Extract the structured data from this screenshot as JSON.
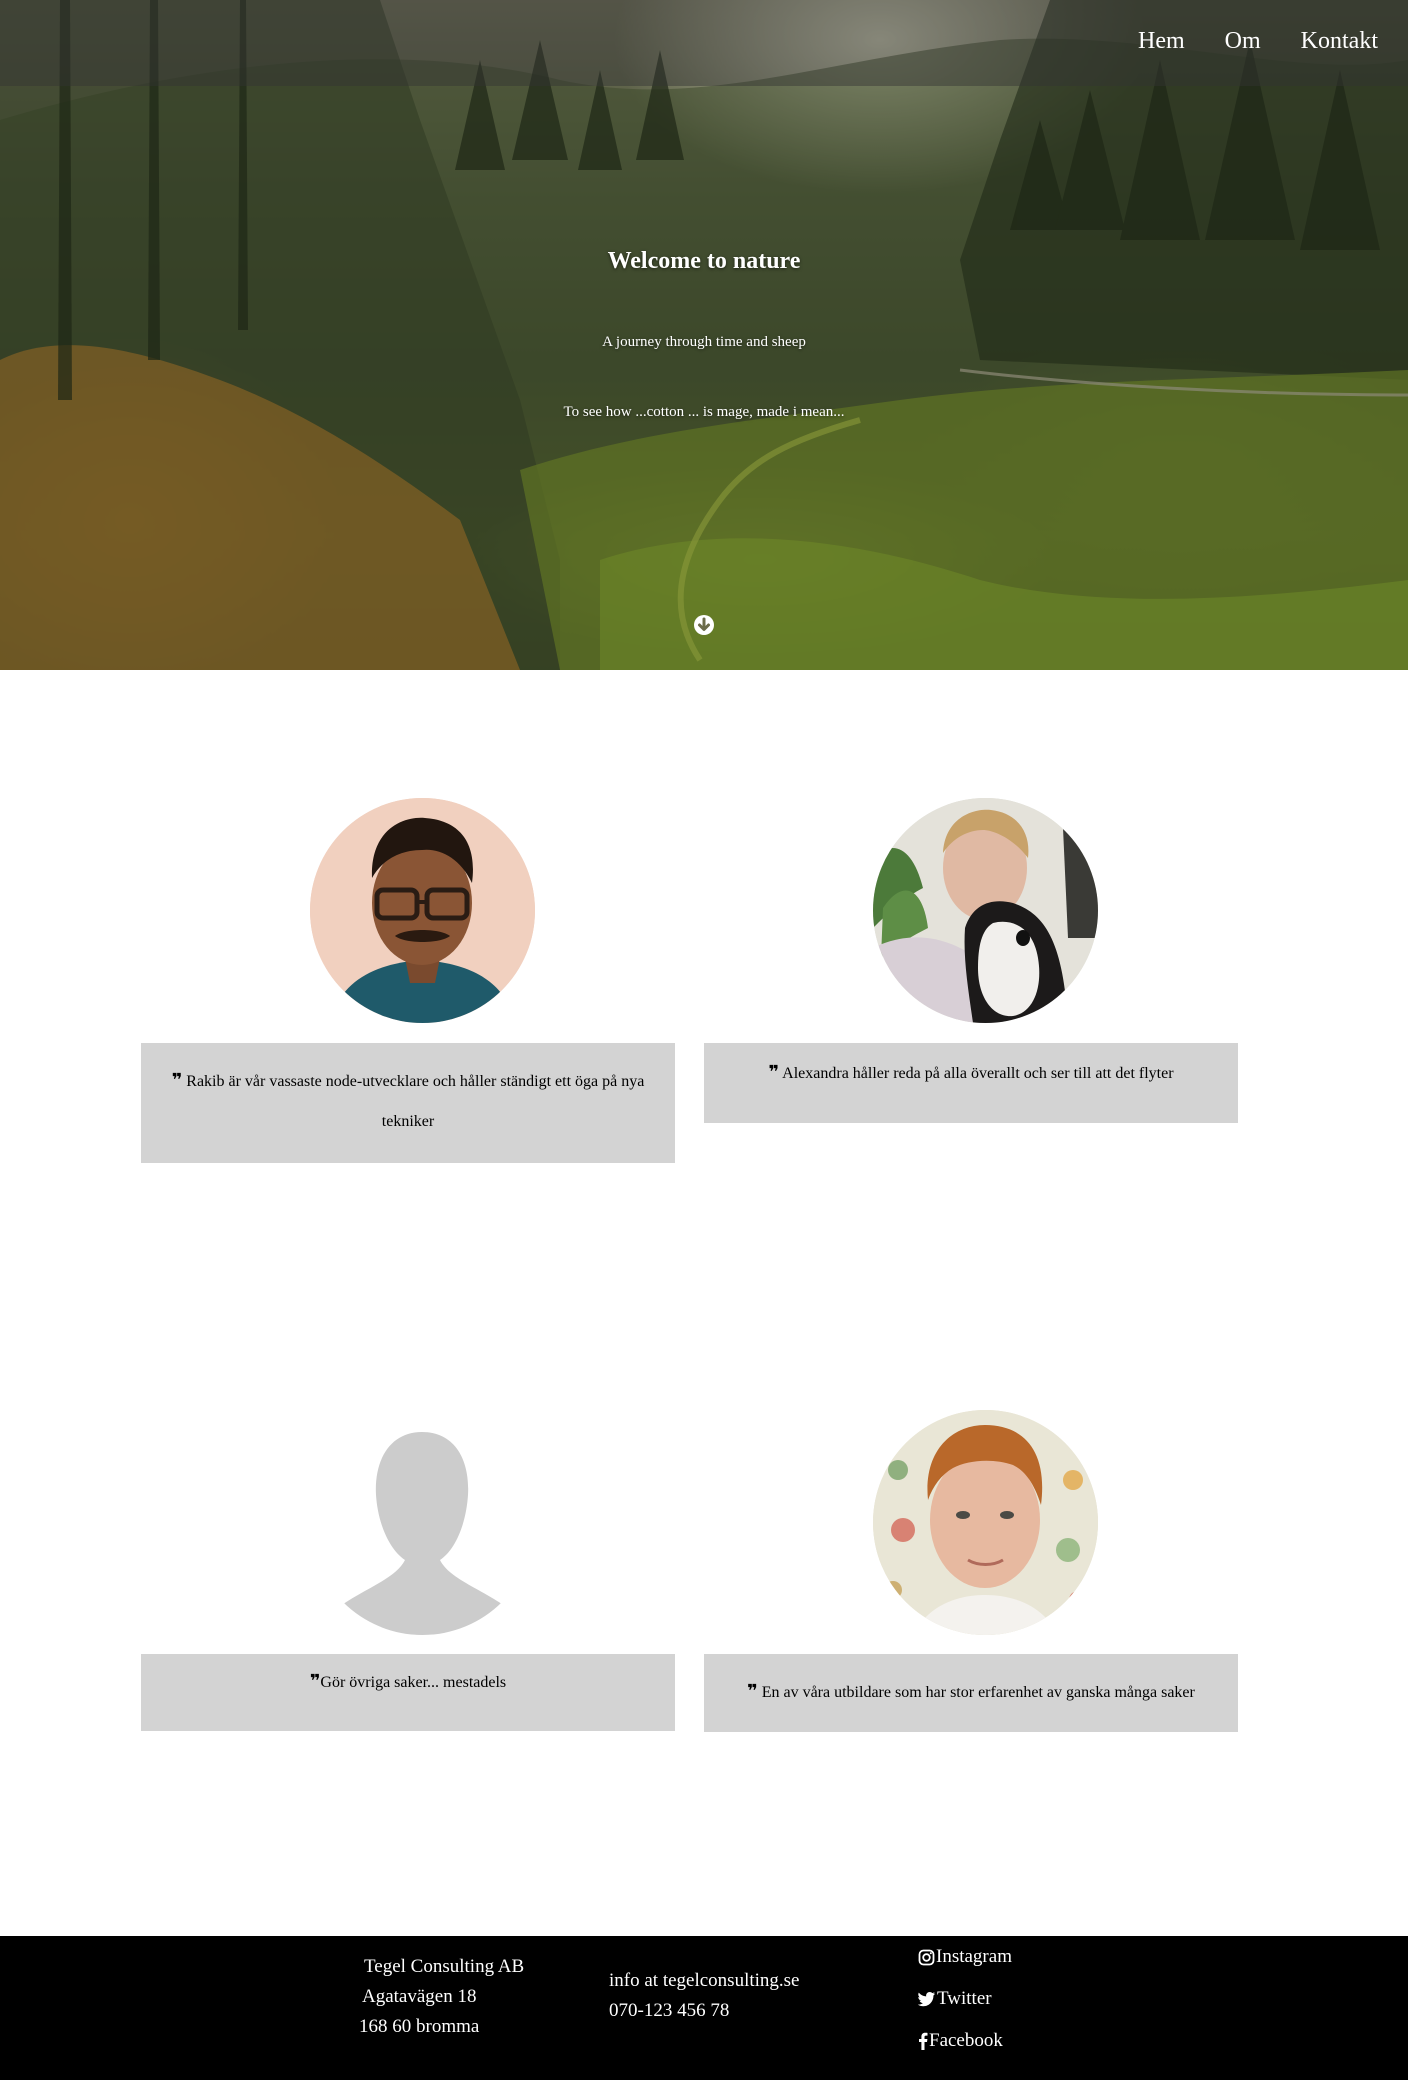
{
  "nav": {
    "items": [
      {
        "label": "Hem"
      },
      {
        "label": "Om"
      },
      {
        "label": "Kontakt"
      }
    ]
  },
  "hero": {
    "title": "Welcome to nature",
    "subtitle": "A journey through time and sheep",
    "text": "To see how ...cotton ... is mage, made i mean..."
  },
  "team": [
    {
      "quote": "Rakib är vår vassaste node-utvecklare och håller ständigt ett öga på nya tekniker"
    },
    {
      "quote": "Alexandra håller reda på alla överallt och ser till att det flyter"
    },
    {
      "quote": "Gör övriga saker... mestadels"
    },
    {
      "quote": "En av våra utbildare som har stor erfarenhet av ganska många saker"
    }
  ],
  "footer": {
    "company": "Tegel Consulting AB",
    "street": "Agatavägen 18",
    "postal": "168 60 bromma",
    "email": "info at tegelconsulting.se",
    "phone": "070-123 456 78",
    "social": [
      {
        "label": "Instagram",
        "icon": "instagram-icon"
      },
      {
        "label": "Twitter",
        "icon": "twitter-icon"
      },
      {
        "label": "Facebook",
        "icon": "facebook-icon"
      }
    ]
  },
  "colors": {
    "quote_bg": "#d3d3d3",
    "footer_bg": "#000000",
    "placeholder_avatar": "#cccccc"
  }
}
